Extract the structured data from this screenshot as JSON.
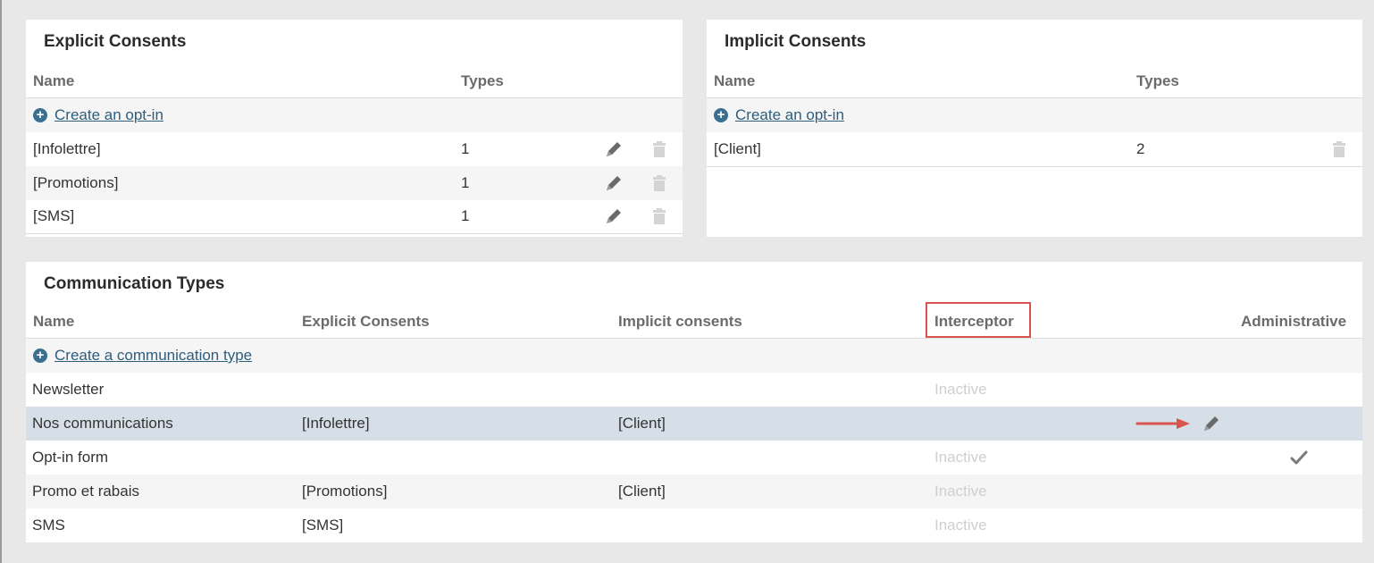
{
  "explicit": {
    "title": "Explicit Consents",
    "headers": {
      "name": "Name",
      "types": "Types"
    },
    "create_label": "Create an opt-in",
    "rows": [
      {
        "name": "[Infolettre]",
        "types": "1"
      },
      {
        "name": "[Promotions]",
        "types": "1"
      },
      {
        "name": "[SMS]",
        "types": "1"
      }
    ]
  },
  "implicit": {
    "title": "Implicit Consents",
    "headers": {
      "name": "Name",
      "types": "Types"
    },
    "create_label": "Create an opt-in",
    "rows": [
      {
        "name": "[Client]",
        "types": "2"
      }
    ]
  },
  "comm": {
    "title": "Communication Types",
    "headers": {
      "name": "Name",
      "explicit": "Explicit Consents",
      "implicit": "Implicit consents",
      "interceptor": "Interceptor",
      "administrative": "Administrative"
    },
    "create_label": "Create a communication type",
    "rows": [
      {
        "name": "Newsletter",
        "explicit": "",
        "implicit": "",
        "interceptor": "Inactive"
      },
      {
        "name": "Nos communications",
        "explicit": "[Infolettre]",
        "implicit": "[Client]",
        "interceptor": ""
      },
      {
        "name": "Opt-in form",
        "explicit": "",
        "implicit": "",
        "interceptor": "Inactive"
      },
      {
        "name": "Promo et rabais",
        "explicit": "[Promotions]",
        "implicit": "[Client]",
        "interceptor": "Inactive"
      },
      {
        "name": "SMS",
        "explicit": "[SMS]",
        "implicit": "",
        "interceptor": "Inactive"
      }
    ]
  },
  "colors": {
    "link": "#2f5d7c",
    "highlight_row": "#d6dfe7",
    "annotation": "#d9534f"
  },
  "icons": [
    "plus-circle-icon",
    "pencil-icon",
    "trash-icon",
    "checkmark-icon",
    "arrow-right-icon"
  ]
}
